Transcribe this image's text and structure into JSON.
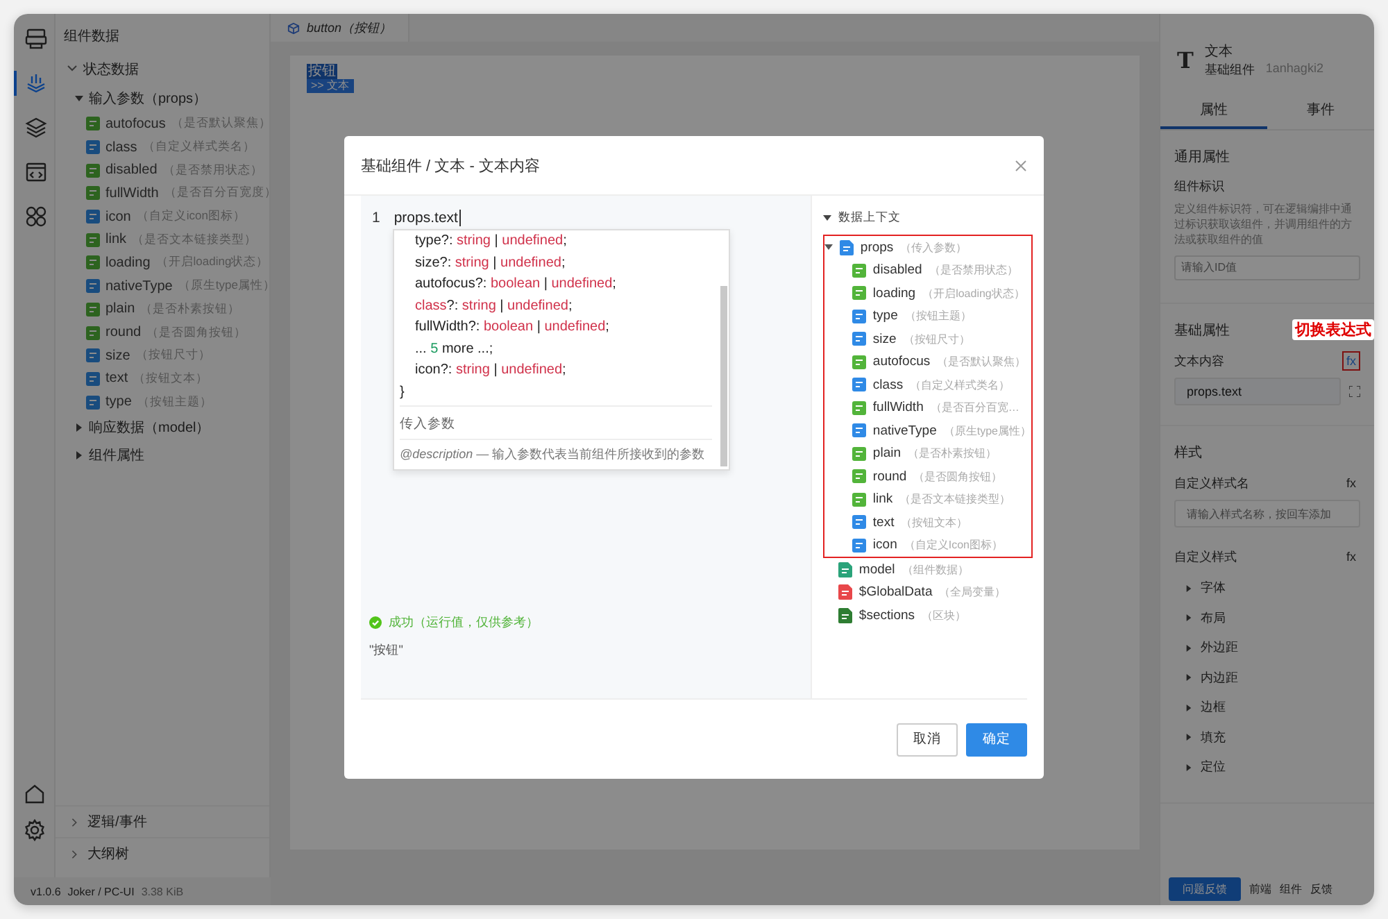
{
  "rail": {
    "top": [
      {
        "kind": "monitor",
        "selected": false
      },
      {
        "kind": "data",
        "selected": true
      },
      {
        "kind": "layers",
        "selected": false
      },
      {
        "kind": "code",
        "selected": false
      },
      {
        "kind": "apps",
        "selected": false
      }
    ],
    "bottom": [
      {
        "kind": "home"
      },
      {
        "kind": "settings"
      }
    ]
  },
  "left_panel": {
    "title": "组件数据",
    "tree": [
      {
        "label": "状态数据",
        "expanded": true,
        "children": [
          {
            "label": "输入参数（props）",
            "expanded": true,
            "children": [
              {
                "name": "autofocus",
                "note": "（是否默认聚焦）",
                "kind": "bool"
              },
              {
                "name": "class",
                "note": "（自定义样式类名）",
                "kind": "str"
              },
              {
                "name": "disabled",
                "note": "（是否禁用状态）",
                "kind": "bool"
              },
              {
                "name": "fullWidth",
                "note": "（是否百分百宽度）",
                "kind": "bool"
              },
              {
                "name": "icon",
                "note": "（自定义icon图标）",
                "kind": "str"
              },
              {
                "name": "link",
                "note": "（是否文本链接类型）",
                "kind": "bool"
              },
              {
                "name": "loading",
                "note": "（开启loading状态）",
                "kind": "bool"
              },
              {
                "name": "nativeType",
                "note": "（原生type属性）",
                "kind": "str"
              },
              {
                "name": "plain",
                "note": "（是否朴素按钮）",
                "kind": "bool"
              },
              {
                "name": "round",
                "note": "（是否圆角按钮）",
                "kind": "bool"
              },
              {
                "name": "size",
                "note": "（按钮尺寸）",
                "kind": "str"
              },
              {
                "name": "text",
                "note": "（按钮文本）",
                "kind": "str"
              },
              {
                "name": "type",
                "note": "（按钮主题）",
                "kind": "str"
              }
            ]
          },
          {
            "label": "响应数据（model）",
            "expanded": false
          },
          {
            "label": "组件属性",
            "expanded": false
          }
        ]
      }
    ],
    "bottom_sections": [
      {
        "label": "逻辑/事件",
        "expanded": false
      },
      {
        "label": "大纲树",
        "expanded": false
      }
    ]
  },
  "status_bar": {
    "version": "v1.0.6",
    "project": "Joker / PC-UI",
    "size": "3.38 KiB"
  },
  "editor_tab": {
    "label": "button（按钮）"
  },
  "canvas": {
    "selection_label": "按钮",
    "breadcrumb": ">> 文本"
  },
  "right_panel": {
    "title": "文本",
    "subtitle": "基础组件",
    "component_id": "1anhagki2",
    "type_letter": "T",
    "tabs": [
      {
        "label": "属性",
        "selected": true
      },
      {
        "label": "事件",
        "selected": false
      }
    ],
    "general": {
      "title": "通用属性",
      "field_label": "组件标识",
      "help": "定义组件标识符，可在逻辑编排中通过标识获取该组件，并调用组件的方法或获取组件的值",
      "placeholder": "请输入ID值"
    },
    "basic": {
      "title": "基础属性",
      "field_label": "文本内容",
      "fx": "fx",
      "fx_highlighted": true,
      "callout": "切换表达式",
      "value": "props.text"
    },
    "style": {
      "title": "样式",
      "class_label": "自定义样式名",
      "class_fx": "fx",
      "class_placeholder": "请输入样式名称，按回车添加",
      "custom_label": "自定义样式",
      "custom_fx": "fx",
      "groups": [
        {
          "label": "字体",
          "expanded": false
        },
        {
          "label": "布局",
          "expanded": false
        },
        {
          "label": "外边距",
          "expanded": false
        },
        {
          "label": "内边距",
          "expanded": false
        },
        {
          "label": "边框",
          "expanded": false
        },
        {
          "label": "填充",
          "expanded": false
        },
        {
          "label": "定位",
          "expanded": false
        }
      ]
    },
    "footer": {
      "feedback_button": "问题反馈",
      "links": [
        "前端",
        "组件",
        "反馈"
      ]
    }
  },
  "modal": {
    "title": "基础组件 / 文本 - 文本内容",
    "editor": {
      "line_number": "1",
      "code": "props.text",
      "tooltip": {
        "lines": [
          {
            "kind": "member",
            "tokens": [
              {
                "t": "type?: ",
                "kind": "plain"
              },
              {
                "t": "string",
                "kind": "type"
              },
              {
                "t": " | ",
                "kind": "plain"
              },
              {
                "t": "undefined",
                "kind": "type"
              },
              {
                "t": ";",
                "kind": "plain"
              }
            ]
          },
          {
            "kind": "member",
            "tokens": [
              {
                "t": "size?: ",
                "kind": "plain"
              },
              {
                "t": "string",
                "kind": "type"
              },
              {
                "t": " | ",
                "kind": "plain"
              },
              {
                "t": "undefined",
                "kind": "type"
              },
              {
                "t": ";",
                "kind": "plain"
              }
            ]
          },
          {
            "kind": "member",
            "tokens": [
              {
                "t": "autofocus?: ",
                "kind": "plain"
              },
              {
                "t": "boolean",
                "kind": "type"
              },
              {
                "t": " | ",
                "kind": "plain"
              },
              {
                "t": "undefined",
                "kind": "type"
              },
              {
                "t": ";",
                "kind": "plain"
              }
            ]
          },
          {
            "kind": "member",
            "tokens": [
              {
                "t": "class",
                "kind": "type"
              },
              {
                "t": "?: ",
                "kind": "plain"
              },
              {
                "t": "string",
                "kind": "type"
              },
              {
                "t": " | ",
                "kind": "plain"
              },
              {
                "t": "undefined",
                "kind": "type"
              },
              {
                "t": ";",
                "kind": "plain"
              }
            ]
          },
          {
            "kind": "member",
            "tokens": [
              {
                "t": "fullWidth?: ",
                "kind": "plain"
              },
              {
                "t": "boolean",
                "kind": "type"
              },
              {
                "t": " | ",
                "kind": "plain"
              },
              {
                "t": "undefined",
                "kind": "type"
              },
              {
                "t": ";",
                "kind": "plain"
              }
            ]
          },
          {
            "kind": "member",
            "tokens": [
              {
                "t": "... ",
                "kind": "plain"
              },
              {
                "t": "5",
                "kind": "number"
              },
              {
                "t": " more ...;",
                "kind": "plain"
              }
            ]
          },
          {
            "kind": "member",
            "tokens": [
              {
                "t": "icon?: ",
                "kind": "plain"
              },
              {
                "t": "string",
                "kind": "type"
              },
              {
                "t": " | ",
                "kind": "plain"
              },
              {
                "t": "undefined",
                "kind": "type"
              },
              {
                "t": ";",
                "kind": "plain"
              }
            ]
          },
          {
            "kind": "close",
            "tokens": [
              {
                "t": "}",
                "kind": "plain"
              }
            ]
          }
        ],
        "summary": "传入参数",
        "doc": "*@description* — 输入参数代表当前组件所接收到的参数"
      },
      "result_status": "成功（运行值，仅供参考）",
      "result_value": "\"按钮\""
    },
    "context": {
      "title": "数据上下文",
      "expanded": true,
      "nodes": [
        {
          "name": "props",
          "note": "（传入参数）",
          "kind": "object",
          "expanded": true,
          "highlighted": true,
          "children": [
            {
              "name": "disabled",
              "note": "（是否禁用状态）",
              "kind": "bool"
            },
            {
              "name": "loading",
              "note": "（开启loading状态）",
              "kind": "bool"
            },
            {
              "name": "type",
              "note": "（按钮主题）",
              "kind": "str"
            },
            {
              "name": "size",
              "note": "（按钮尺寸）",
              "kind": "str"
            },
            {
              "name": "autofocus",
              "note": "（是否默认聚焦）",
              "kind": "bool"
            },
            {
              "name": "class",
              "note": "（自定义样式类名）",
              "kind": "str"
            },
            {
              "name": "fullWidth",
              "note": "（是否百分百宽…",
              "kind": "bool"
            },
            {
              "name": "nativeType",
              "note": "（原生type属性）",
              "kind": "str"
            },
            {
              "name": "plain",
              "note": "（是否朴素按钮）",
              "kind": "bool"
            },
            {
              "name": "round",
              "note": "（是否圆角按钮）",
              "kind": "bool"
            },
            {
              "name": "link",
              "note": "（是否文本链接类型）",
              "kind": "bool"
            },
            {
              "name": "text",
              "note": "（按钮文本）",
              "kind": "str"
            },
            {
              "name": "icon",
              "note": "（自定义Icon图标）",
              "kind": "str"
            }
          ]
        },
        {
          "name": "model",
          "note": "（组件数据）",
          "kind": "model"
        },
        {
          "name": "$GlobalData",
          "note": "（全局变量）",
          "kind": "global"
        },
        {
          "name": "$sections",
          "note": "（区块）",
          "kind": "sections"
        }
      ]
    },
    "buttons": [
      {
        "label": "取消",
        "kind": "default"
      },
      {
        "label": "确定",
        "kind": "primary"
      }
    ]
  }
}
